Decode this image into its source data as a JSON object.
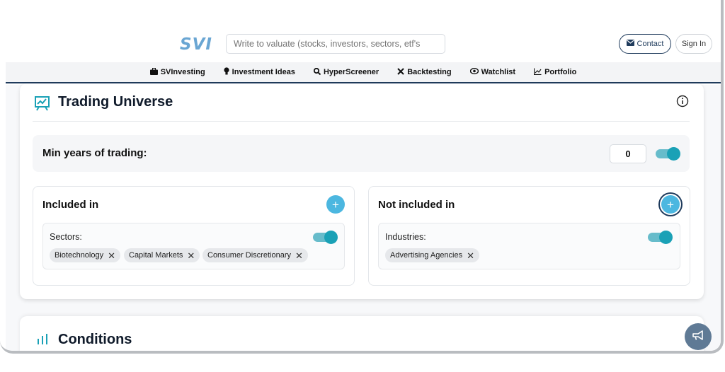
{
  "header": {
    "logo_text": "SVI",
    "search_placeholder": "Write to valuate (stocks, investors, sectors, etf's",
    "contact_label": "Contact",
    "signin_label": "Sign In"
  },
  "nav": {
    "items": [
      {
        "label": "SVInvesting",
        "icon": "briefcase-icon"
      },
      {
        "label": "Investment Ideas",
        "icon": "lightbulb-icon"
      },
      {
        "label": "HyperScreener",
        "icon": "search-icon"
      },
      {
        "label": "Backtesting",
        "icon": "tools-icon"
      },
      {
        "label": "Watchlist",
        "icon": "eye-icon"
      },
      {
        "label": "Portfolio",
        "icon": "chart-line-icon"
      }
    ]
  },
  "trading_universe": {
    "title": "Trading Universe",
    "min_years_label": "Min years of trading:",
    "min_years_value": "0",
    "min_years_toggle_on": true,
    "included": {
      "title": "Included in",
      "add_label": "+",
      "group_label": "Sectors:",
      "toggle_on": true,
      "chips": [
        "Biotechnology",
        "Capital Markets",
        "Consumer Discretionary"
      ]
    },
    "not_included": {
      "title": "Not included in",
      "add_label": "+",
      "group_label": "Industries:",
      "toggle_on": true,
      "chips": [
        "Advertising Agencies"
      ]
    }
  },
  "conditions": {
    "title": "Conditions"
  },
  "colors": {
    "accent": "#1aa1b6",
    "navy": "#1f3b5c",
    "add_button": "#4cb7e0",
    "logo": "#6aa6d3"
  }
}
